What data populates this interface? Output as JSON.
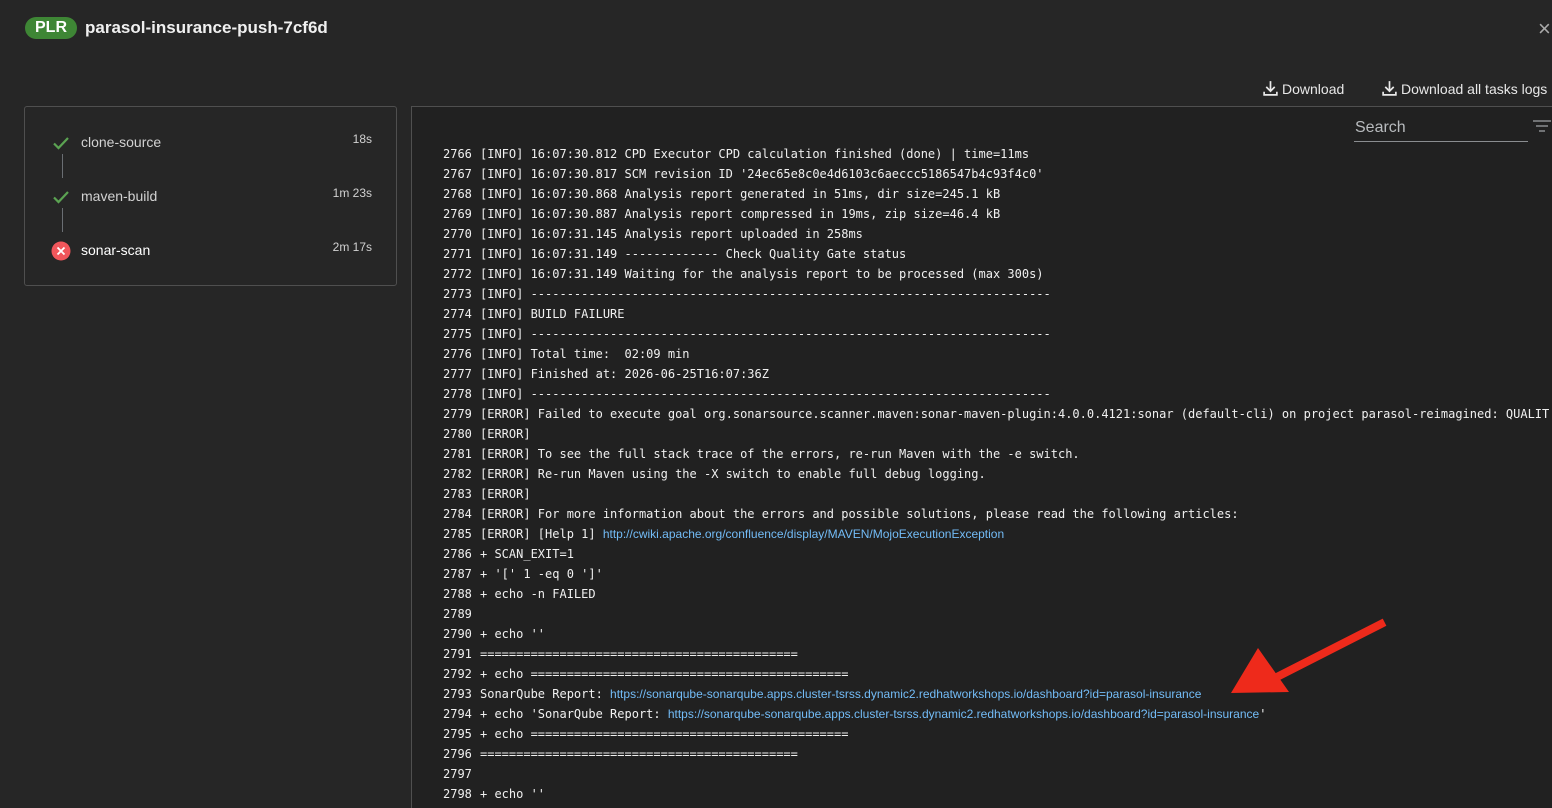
{
  "header": {
    "badge": "PLR",
    "title": "parasol-insurance-push-7cf6d",
    "close_glyph": "×"
  },
  "toolbar": {
    "download_label": "Download",
    "download_all_label": "Download all tasks logs"
  },
  "tasks": [
    {
      "name": "clone-source",
      "duration": "18s",
      "status": "succeeded",
      "icon": "check-icon"
    },
    {
      "name": "maven-build",
      "duration": "1m 23s",
      "status": "succeeded",
      "icon": "check-icon"
    },
    {
      "name": "sonar-scan",
      "duration": "2m 17s",
      "status": "failed",
      "icon": "error-circle-icon"
    }
  ],
  "colors": {
    "success": "#5ba352",
    "failed": "#f0565b",
    "badge": "#3e8635",
    "link": "#73bcf7",
    "annotation_arrow": "#ee2a1b"
  },
  "log": {
    "search_placeholder": "Search",
    "lines": [
      {
        "n": "2766",
        "text": "[INFO] 16:07:30.812 CPD Executor CPD calculation finished (done) | time=11ms"
      },
      {
        "n": "2767",
        "text": "[INFO] 16:07:30.817 SCM revision ID '24ec65e8c0e4d6103c6aeccc5186547b4c93f4c0'"
      },
      {
        "n": "2768",
        "text": "[INFO] 16:07:30.868 Analysis report generated in 51ms, dir size=245.1 kB"
      },
      {
        "n": "2769",
        "text": "[INFO] 16:07:30.887 Analysis report compressed in 19ms, zip size=46.4 kB"
      },
      {
        "n": "2770",
        "text": "[INFO] 16:07:31.145 Analysis report uploaded in 258ms"
      },
      {
        "n": "2771",
        "text": "[INFO] 16:07:31.149 ------------- Check Quality Gate status"
      },
      {
        "n": "2772",
        "text": "[INFO] 16:07:31.149 Waiting for the analysis report to be processed (max 300s)"
      },
      {
        "n": "2773",
        "text": "[INFO] ------------------------------------------------------------------------"
      },
      {
        "n": "2774",
        "text": "[INFO] BUILD FAILURE"
      },
      {
        "n": "2775",
        "text": "[INFO] ------------------------------------------------------------------------"
      },
      {
        "n": "2776",
        "text": "[INFO] Total time:  02:09 min"
      },
      {
        "n": "2777",
        "text": "[INFO] Finished at: 2026-06-25T16:07:36Z"
      },
      {
        "n": "2778",
        "text": "[INFO] ------------------------------------------------------------------------"
      },
      {
        "n": "2779",
        "text": "[ERROR] Failed to execute goal org.sonarsource.scanner.maven:sonar-maven-plugin:4.0.0.4121:sonar (default-cli) on project parasol-reimagined: QUALIT"
      },
      {
        "n": "2780",
        "text": "[ERROR]"
      },
      {
        "n": "2781",
        "text": "[ERROR] To see the full stack trace of the errors, re-run Maven with the -e switch."
      },
      {
        "n": "2782",
        "text": "[ERROR] Re-run Maven using the -X switch to enable full debug logging."
      },
      {
        "n": "2783",
        "text": "[ERROR]"
      },
      {
        "n": "2784",
        "text": "[ERROR] For more information about the errors and possible solutions, please read the following articles:"
      },
      {
        "n": "2785",
        "text": "[ERROR] [Help 1] ",
        "link": "http://cwiki.apache.org/confluence/display/MAVEN/MojoExecutionException"
      },
      {
        "n": "2786",
        "text": "+ SCAN_EXIT=1"
      },
      {
        "n": "2787",
        "text": "+ '[' 1 -eq 0 ']'"
      },
      {
        "n": "2788",
        "text": "+ echo -n FAILED"
      },
      {
        "n": "2789",
        "text": ""
      },
      {
        "n": "2790",
        "text": "+ echo ''"
      },
      {
        "n": "2791",
        "text": "============================================"
      },
      {
        "n": "2792",
        "text": "+ echo ============================================"
      },
      {
        "n": "2793",
        "text": "SonarQube Report: ",
        "link": "https://sonarqube-sonarqube.apps.cluster-tsrss.dynamic2.redhatworkshops.io/dashboard?id=parasol-insurance"
      },
      {
        "n": "2794",
        "text": "+ echo 'SonarQube Report: ",
        "link": "https://sonarqube-sonarqube.apps.cluster-tsrss.dynamic2.redhatworkshops.io/dashboard?id=parasol-insurance",
        "suffix": "'"
      },
      {
        "n": "2795",
        "text": "+ echo ============================================"
      },
      {
        "n": "2796",
        "text": "============================================"
      },
      {
        "n": "2797",
        "text": ""
      },
      {
        "n": "2798",
        "text": "+ echo ''"
      }
    ]
  }
}
